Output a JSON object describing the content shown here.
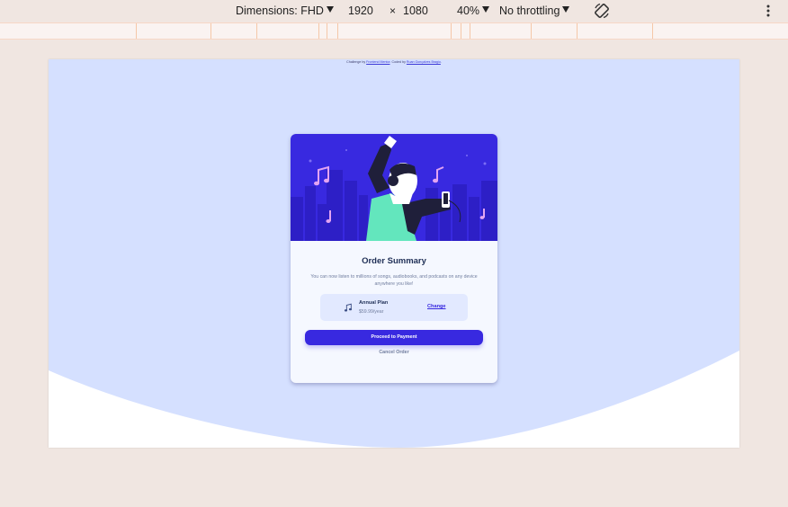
{
  "devtools": {
    "dimensions_label": "Dimensions: FHD",
    "width": "1920",
    "times": "×",
    "height": "1080",
    "zoom": "40%",
    "throttling": "No throttling",
    "rotate_icon": "rotate-icon",
    "more_icon": "more-vertical-icon"
  },
  "page": {
    "attribution": {
      "prefix": "Challenge by",
      "challenge_link": "Frontend Mentor",
      "middle": ". Coded by",
      "author_link": "Ruan Gonçalves Bragio",
      "suffix": "."
    },
    "card": {
      "title": "Order Summary",
      "description": "You can now listen to millions of songs, audiobooks, and podcasts on any device anywhere you like!",
      "plan_icon": "music-note-icon",
      "plan_name": "Annual Plan",
      "plan_price": "$59.99/year",
      "change_label": "Change",
      "pay_label": "Proceed to Payment",
      "cancel_label": "Cancel Order"
    }
  },
  "colors": {
    "page_bg": "#f0e6e1",
    "hero_bg": "#d5e0ff",
    "primary": "#3829e0",
    "card_bg": "#f5f8ff",
    "plan_bg": "#e2e9ff",
    "title": "#1f2f56",
    "muted": "#707d9e"
  }
}
